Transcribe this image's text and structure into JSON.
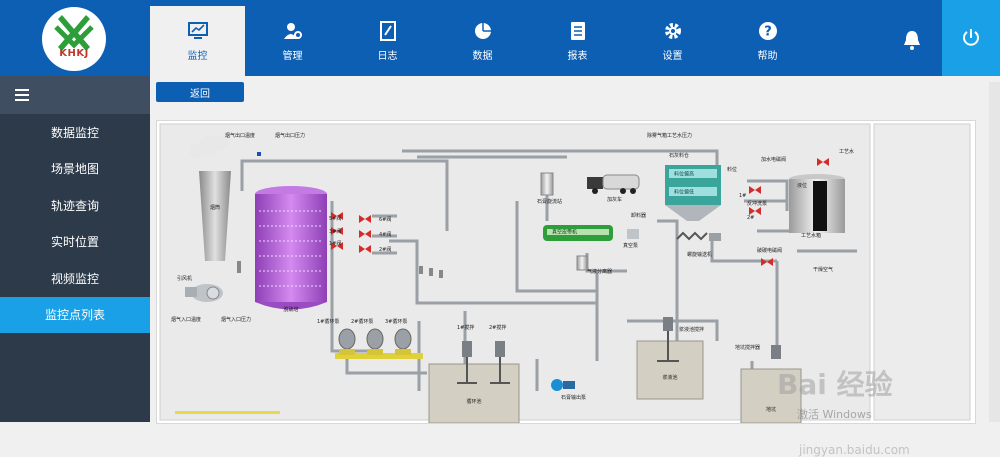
{
  "brand": {
    "logo_text": "KHKJ"
  },
  "nav": [
    {
      "label": "监控",
      "icon": "monitor-icon",
      "active": true
    },
    {
      "label": "管理",
      "icon": "user-gear-icon",
      "active": false
    },
    {
      "label": "日志",
      "icon": "notebook-icon",
      "active": false
    },
    {
      "label": "数据",
      "icon": "pie-chart-icon",
      "active": false
    },
    {
      "label": "报表",
      "icon": "document-icon",
      "active": false
    },
    {
      "label": "设置",
      "icon": "gear-icon",
      "active": false
    },
    {
      "label": "帮助",
      "icon": "help-icon",
      "active": false
    }
  ],
  "sidebar": {
    "items": [
      {
        "label": "数据监控"
      },
      {
        "label": "场景地图"
      },
      {
        "label": "轨迹查询"
      },
      {
        "label": "实时位置"
      },
      {
        "label": "视频监控"
      },
      {
        "label": "监控点列表",
        "active": true
      }
    ]
  },
  "content": {
    "back_label": "返回"
  },
  "diagram": {
    "labels": {
      "smoke_out_temp": "烟气出口温度",
      "smoke_out_pressure": "烟气出口压力",
      "chimney": "烟筒",
      "fan": "引风机",
      "smoke_in_temp": "烟气入口温度",
      "smoke_in_pressure": "烟气入口压力",
      "tower": "脱硫塔",
      "v5": "5#阀",
      "v6": "6#阀",
      "v4": "4#阀",
      "v3": "3#阀",
      "v2": "2#阀",
      "v1": "1#阀",
      "pump1": "1#循环泵",
      "pump2": "2#循环泵",
      "pump3": "3#循环泵",
      "stir1": "1#搅拌",
      "stir2": "2#搅拌",
      "cycle_pool": "循环池",
      "gypsum_cyclone": "石膏旋流站",
      "vacuum_belt": "真空皮带机",
      "vacuum_pump": "真空泵",
      "gas_sep": "气液分离器",
      "gypsum_pump": "石膏输出泵",
      "lime_bin": "石灰料仓",
      "bin_high": "料位偏高",
      "bin_low": "料位偏低",
      "bin_level": "料位",
      "lime_truck": "加灰车",
      "feeder": "卸料器",
      "screw": "螺旋输送机",
      "slurry_stir": "浆液池搅拌",
      "slurry_pool": "浆液池",
      "pit_stir": "地坑搅拌器",
      "pit": "地坑",
      "dust_pressure": "除雾气箱工艺水压力",
      "water_valve": "加水电磁阀",
      "process_water": "工艺水",
      "level": "液位",
      "backwash": "反冲洗泵",
      "backwash_1": "1#",
      "backwash_2": "2#",
      "water_tank": "工艺水箱",
      "lime_valve": "破碳电磁阀",
      "dry_air": "干燥空气"
    }
  },
  "watermark": {
    "brand": "Bai 经验",
    "windows": "激活 Windows",
    "url": "jingyan.baidu.com"
  },
  "colors": {
    "primary": "#0d5fb3",
    "accent": "#1aa0e6",
    "sidebar": "#2d3a4a",
    "tower": "#b35ad8"
  }
}
